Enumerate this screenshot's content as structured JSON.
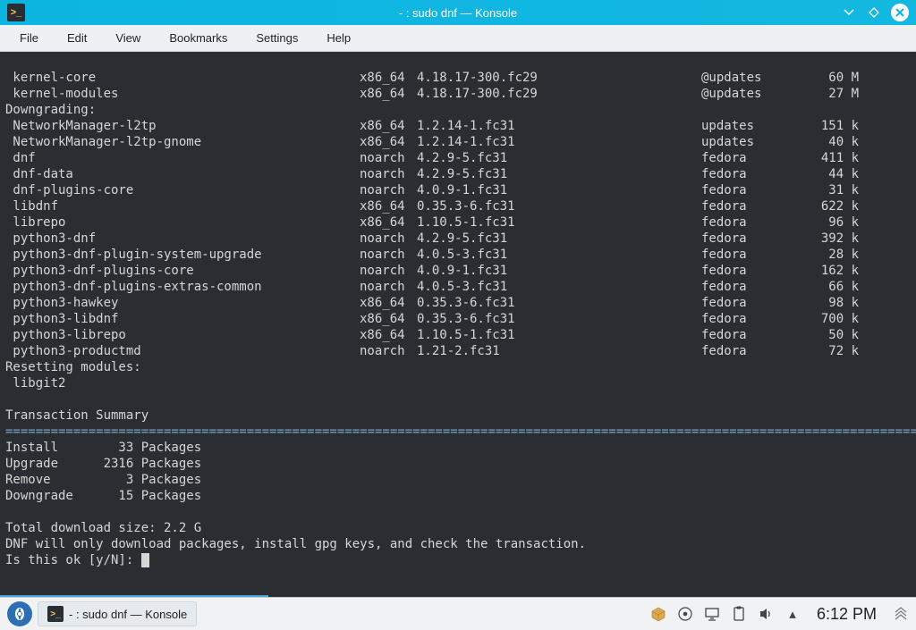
{
  "window": {
    "title": "- : sudo dnf — Konsole"
  },
  "menubar": {
    "items": [
      "File",
      "Edit",
      "View",
      "Bookmarks",
      "Settings",
      "Help"
    ]
  },
  "terminal": {
    "pre_rows": [
      {
        "pkg": " kernel-core",
        "arch": "x86_64",
        "ver": "4.18.17-300.fc29",
        "repo": "@updates",
        "size": "60 M"
      },
      {
        "pkg": " kernel-modules",
        "arch": "x86_64",
        "ver": "4.18.17-300.fc29",
        "repo": "@updates",
        "size": "27 M"
      }
    ],
    "downgrading_label": "Downgrading:",
    "downgrading_rows": [
      {
        "pkg": " NetworkManager-l2tp",
        "arch": "x86_64",
        "ver": "1.2.14-1.fc31",
        "repo": "updates",
        "size": "151 k"
      },
      {
        "pkg": " NetworkManager-l2tp-gnome",
        "arch": "x86_64",
        "ver": "1.2.14-1.fc31",
        "repo": "updates",
        "size": "40 k"
      },
      {
        "pkg": " dnf",
        "arch": "noarch",
        "ver": "4.2.9-5.fc31",
        "repo": "fedora",
        "size": "411 k"
      },
      {
        "pkg": " dnf-data",
        "arch": "noarch",
        "ver": "4.2.9-5.fc31",
        "repo": "fedora",
        "size": "44 k"
      },
      {
        "pkg": " dnf-plugins-core",
        "arch": "noarch",
        "ver": "4.0.9-1.fc31",
        "repo": "fedora",
        "size": "31 k"
      },
      {
        "pkg": " libdnf",
        "arch": "x86_64",
        "ver": "0.35.3-6.fc31",
        "repo": "fedora",
        "size": "622 k"
      },
      {
        "pkg": " librepo",
        "arch": "x86_64",
        "ver": "1.10.5-1.fc31",
        "repo": "fedora",
        "size": "96 k"
      },
      {
        "pkg": " python3-dnf",
        "arch": "noarch",
        "ver": "4.2.9-5.fc31",
        "repo": "fedora",
        "size": "392 k"
      },
      {
        "pkg": " python3-dnf-plugin-system-upgrade",
        "arch": "noarch",
        "ver": "4.0.5-3.fc31",
        "repo": "fedora",
        "size": "28 k"
      },
      {
        "pkg": " python3-dnf-plugins-core",
        "arch": "noarch",
        "ver": "4.0.9-1.fc31",
        "repo": "fedora",
        "size": "162 k"
      },
      {
        "pkg": " python3-dnf-plugins-extras-common",
        "arch": "noarch",
        "ver": "4.0.5-3.fc31",
        "repo": "fedora",
        "size": "66 k"
      },
      {
        "pkg": " python3-hawkey",
        "arch": "x86_64",
        "ver": "0.35.3-6.fc31",
        "repo": "fedora",
        "size": "98 k"
      },
      {
        "pkg": " python3-libdnf",
        "arch": "x86_64",
        "ver": "0.35.3-6.fc31",
        "repo": "fedora",
        "size": "700 k"
      },
      {
        "pkg": " python3-librepo",
        "arch": "x86_64",
        "ver": "1.10.5-1.fc31",
        "repo": "fedora",
        "size": "50 k"
      },
      {
        "pkg": " python3-productmd",
        "arch": "noarch",
        "ver": "1.21-2.fc31",
        "repo": "fedora",
        "size": "72 k"
      }
    ],
    "resetting_label": "Resetting modules:",
    "resetting_rows": [
      " libgit2"
    ],
    "summary_heading": "Transaction Summary",
    "separator": "================================================================================================================================",
    "summary": [
      {
        "label": "Install",
        "count": "33",
        "unit": "Packages"
      },
      {
        "label": "Upgrade",
        "count": "2316",
        "unit": "Packages"
      },
      {
        "label": "Remove",
        "count": "3",
        "unit": "Packages"
      },
      {
        "label": "Downgrade",
        "count": "15",
        "unit": "Packages"
      }
    ],
    "total_line": "Total download size: 2.2 G",
    "dnf_note": "DNF will only download packages, install gpg keys, and check the transaction.",
    "prompt": "Is this ok [y/N]: "
  },
  "taskbar": {
    "task_label": "- : sudo dnf — Konsole",
    "clock": "6:12 PM"
  }
}
